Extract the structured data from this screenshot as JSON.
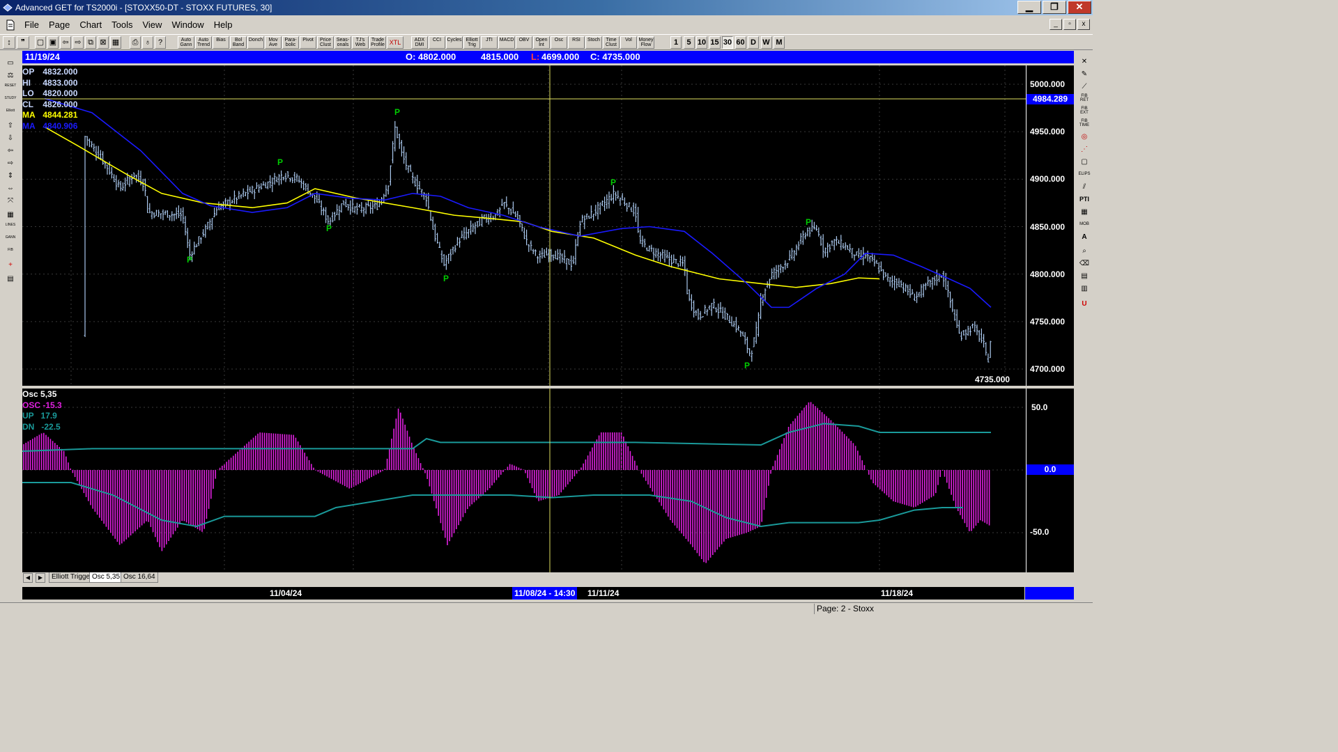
{
  "window": {
    "title": "Advanced GET for TS2000i - [STOXX50-DT - STOXX FUTURES, 30]",
    "minimize_label": "▁",
    "maximize_label": "❐",
    "close_label": "✕"
  },
  "menubar": {
    "items": [
      "File",
      "Page",
      "Chart",
      "Tools",
      "View",
      "Window",
      "Help"
    ]
  },
  "toolbar": {
    "study_buttons": [
      "Auto Gann",
      "Auto Trend",
      "Bias",
      "Bol Band",
      "Donch",
      "Mov Ave",
      "Para-bolic",
      "Pivot",
      "Price Clust",
      "Seas-onals",
      "TJ's Web",
      "Trade Profile",
      "XTL",
      "ADX DMI",
      "CCI",
      "Cycles",
      "Elliott Trig",
      "JTI",
      "MACD",
      "OBV",
      "Open Int",
      "Osc",
      "RSI",
      "Stoch",
      "Time Clust",
      "Vol",
      "Money Flow"
    ],
    "periods": [
      "1",
      "5",
      "10",
      "15",
      "30",
      "60",
      "D",
      "W",
      "M"
    ],
    "active_period": "30"
  },
  "infobar": {
    "date": "11/19/24",
    "open": "O: 4802.000",
    "high": "4815.000",
    "low_label": "L:",
    "low": "4699.000",
    "close": "C: 4735.000"
  },
  "price_panel": {
    "legend": {
      "op": {
        "label": "OP",
        "value": "4832.000"
      },
      "hi": {
        "label": "HI",
        "value": "4833.000"
      },
      "lo": {
        "label": "LO",
        "value": "4820.000"
      },
      "cl": {
        "label": "CL",
        "value": "4826.000"
      },
      "ma1": {
        "label": "MA",
        "value": "4844.281"
      },
      "ma2": {
        "label": "MA",
        "value": "4840.906"
      }
    },
    "y_labels": [
      "5000.000",
      "4950.000",
      "4900.000",
      "4850.000",
      "4800.000",
      "4750.000",
      "4700.000"
    ],
    "cursor_price": "4984.289",
    "last_price": "4735.000",
    "pivot_marker": "P",
    "colors": {
      "ma_fast": "#ffff00",
      "ma_slow": "#1a1aff",
      "pivot": "#00cc00"
    }
  },
  "osc_panel": {
    "legend": {
      "title": "Osc 5,35",
      "osc": {
        "label": "OSC",
        "value": "-15.3"
      },
      "up": {
        "label": "UP",
        "value": "17.9"
      },
      "dn": {
        "label": "DN",
        "value": "-22.5"
      }
    },
    "y_labels": [
      "50.0",
      "0.0",
      "-50.0"
    ],
    "colors": {
      "osc": "#e020e0",
      "bands": "#1a9a9a"
    }
  },
  "tabs": [
    "Elliott Trigger",
    "Osc 5,35",
    "Osc 16,64"
  ],
  "active_tab": "Osc 5,35",
  "dates": {
    "d1": "11/04/24",
    "cursor": "11/08/24 - 14:30",
    "d2": "11/11/24",
    "d3": "11/18/24"
  },
  "status": {
    "page": "Page: 2 - Stoxx"
  }
}
